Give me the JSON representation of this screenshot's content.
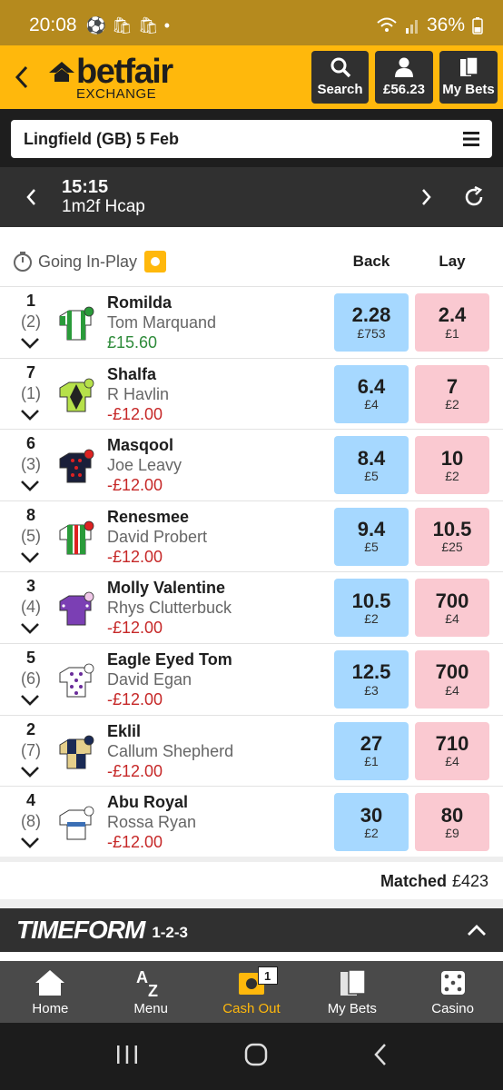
{
  "status_bar": {
    "time": "20:08",
    "battery": "36%"
  },
  "header": {
    "logo_text": "betfair",
    "logo_sub": "EXCHANGE",
    "buttons": {
      "search": "Search",
      "balance": "£56.23",
      "my_bets": "My Bets"
    }
  },
  "event": {
    "name": "Lingfield (GB) 5 Feb"
  },
  "race": {
    "time": "15:15",
    "name": "1m2f Hcap"
  },
  "market": {
    "inplay_label": "Going In-Play",
    "back_label": "Back",
    "lay_label": "Lay"
  },
  "runners": [
    {
      "num": "1",
      "draw": "(2)",
      "name": "Romilda",
      "jockey": "Tom Marquand",
      "pl": "£15.60",
      "pl_type": "pos",
      "back": "2.28",
      "back_size": "£753",
      "lay": "2.4",
      "lay_size": "£1",
      "silk": "green-stripes"
    },
    {
      "num": "7",
      "draw": "(1)",
      "name": "Shalfa",
      "jockey": "R Havlin",
      "pl": "-£12.00",
      "pl_type": "neg",
      "back": "6.4",
      "back_size": "£4",
      "lay": "7",
      "lay_size": "£2",
      "silk": "lime-diamond"
    },
    {
      "num": "6",
      "draw": "(3)",
      "name": "Masqool",
      "jockey": "Joe Leavy",
      "pl": "-£12.00",
      "pl_type": "neg",
      "back": "8.4",
      "back_size": "£5",
      "lay": "10",
      "lay_size": "£2",
      "silk": "navy-red-spots"
    },
    {
      "num": "8",
      "draw": "(5)",
      "name": "Renesmee",
      "jockey": "David Probert",
      "pl": "-£12.00",
      "pl_type": "neg",
      "back": "9.4",
      "back_size": "£5",
      "lay": "10.5",
      "lay_size": "£25",
      "silk": "green-red-stripes"
    },
    {
      "num": "3",
      "draw": "(4)",
      "name": "Molly Valentine",
      "jockey": "Rhys Clutterbuck",
      "pl": "-£12.00",
      "pl_type": "neg",
      "back": "10.5",
      "back_size": "£2",
      "lay": "700",
      "lay_size": "£4",
      "silk": "purple"
    },
    {
      "num": "5",
      "draw": "(6)",
      "name": "Eagle Eyed Tom",
      "jockey": "David Egan",
      "pl": "-£12.00",
      "pl_type": "neg",
      "back": "12.5",
      "back_size": "£3",
      "lay": "700",
      "lay_size": "£4",
      "silk": "white-purple-spots"
    },
    {
      "num": "2",
      "draw": "(7)",
      "name": "Eklil",
      "jockey": "Callum Shepherd",
      "pl": "-£12.00",
      "pl_type": "neg",
      "back": "27",
      "back_size": "£1",
      "lay": "710",
      "lay_size": "£4",
      "silk": "navy-gold-quarters"
    },
    {
      "num": "4",
      "draw": "(8)",
      "name": "Abu Royal",
      "jockey": "Rossa Ryan",
      "pl": "-£12.00",
      "pl_type": "neg",
      "back": "30",
      "back_size": "£2",
      "lay": "80",
      "lay_size": "£9",
      "silk": "white-blue-band"
    }
  ],
  "matched": {
    "label": "Matched",
    "value": "£423"
  },
  "timeform": {
    "brand": "TIMEFORM",
    "sub": "1-2-3"
  },
  "bottom_nav": {
    "home": "Home",
    "menu": "Menu",
    "cash_out": "Cash Out",
    "cash_out_badge": "1",
    "my_bets": "My Bets",
    "casino": "Casino"
  },
  "colors": {
    "brand_yellow": "#ffb80c",
    "back_blue": "#a6d8ff",
    "lay_pink": "#fac9d1",
    "profit_green": "#2e8b3a",
    "loss_red": "#c62828"
  }
}
